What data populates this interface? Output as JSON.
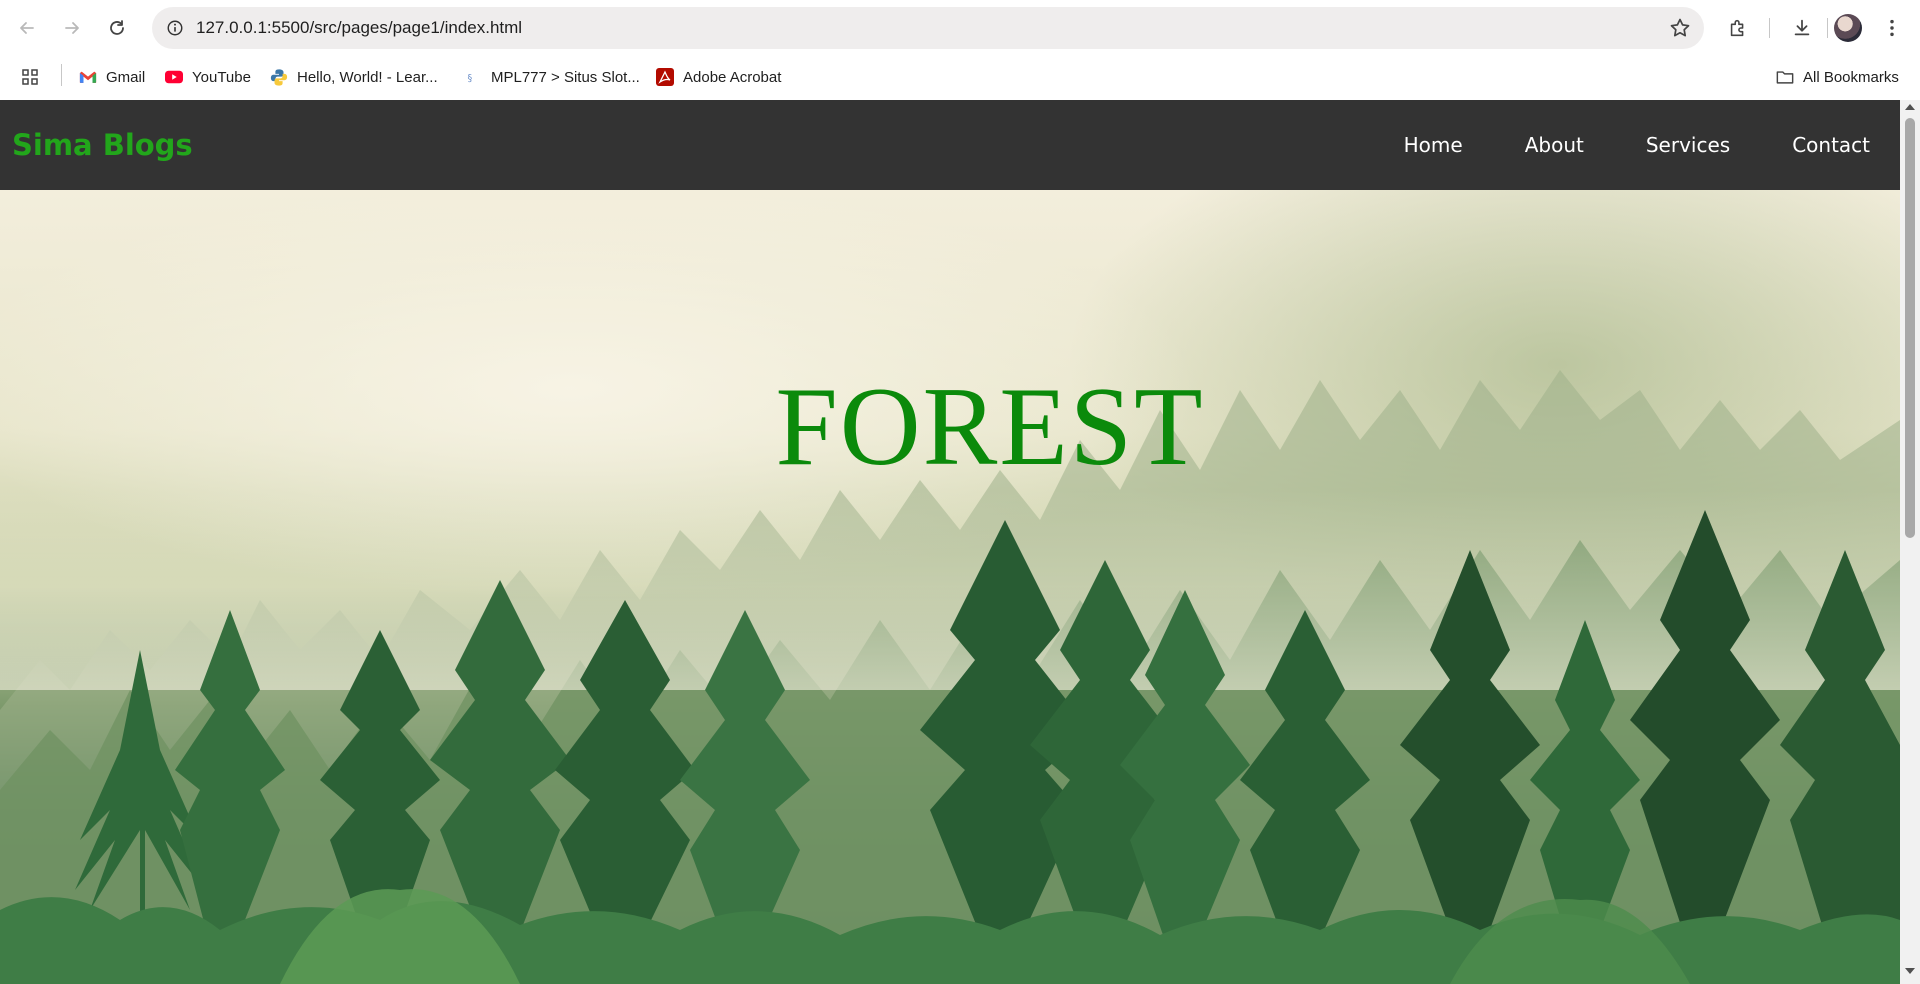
{
  "browser": {
    "url": "127.0.0.1:5500/src/pages/page1/index.html",
    "bookmarks": [
      {
        "label": "Gmail",
        "icon": "gmail-icon"
      },
      {
        "label": "YouTube",
        "icon": "youtube-icon"
      },
      {
        "label": "Hello, World! - Lear...",
        "icon": "python-icon"
      },
      {
        "label": "MPL777 > Situs Slot...",
        "icon": "site-icon"
      },
      {
        "label": "Adobe Acrobat",
        "icon": "acrobat-icon"
      }
    ],
    "all_bookmarks_label": "All Bookmarks"
  },
  "site": {
    "logo": "Sima Blogs",
    "nav": [
      "Home",
      "About",
      "Services",
      "Contact"
    ],
    "hero_title": "FOREST"
  },
  "colors": {
    "nav_bg": "#333333",
    "logo": "#22a61b",
    "hero_title": "#0b8a0b"
  }
}
